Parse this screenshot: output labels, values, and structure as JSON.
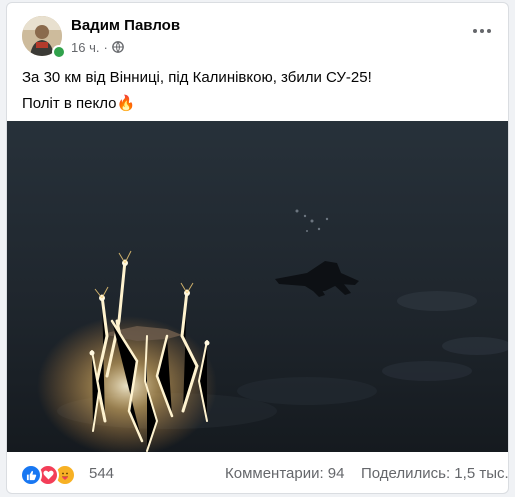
{
  "post": {
    "author": "Вадим Павлов",
    "time": "16 ч.",
    "separator": "·",
    "privacy_icon": "globe-icon",
    "text_line1": "За 30 км від Вінниці, під Калинівкою, збили СУ-25!",
    "text_line2": "Політ в пекло",
    "text_emoji": "🔥"
  },
  "footer": {
    "reaction_icons": [
      "like-icon",
      "love-icon",
      "care-icon"
    ],
    "reaction_count": "544",
    "comments": "Комментарии: 94",
    "shares": "Поделились: 1,5 тыс."
  },
  "colors": {
    "like": "#1877f2",
    "love": "#f33e58",
    "care": "#f7b125",
    "online": "#31a24c",
    "secondary_text": "#65676b"
  }
}
